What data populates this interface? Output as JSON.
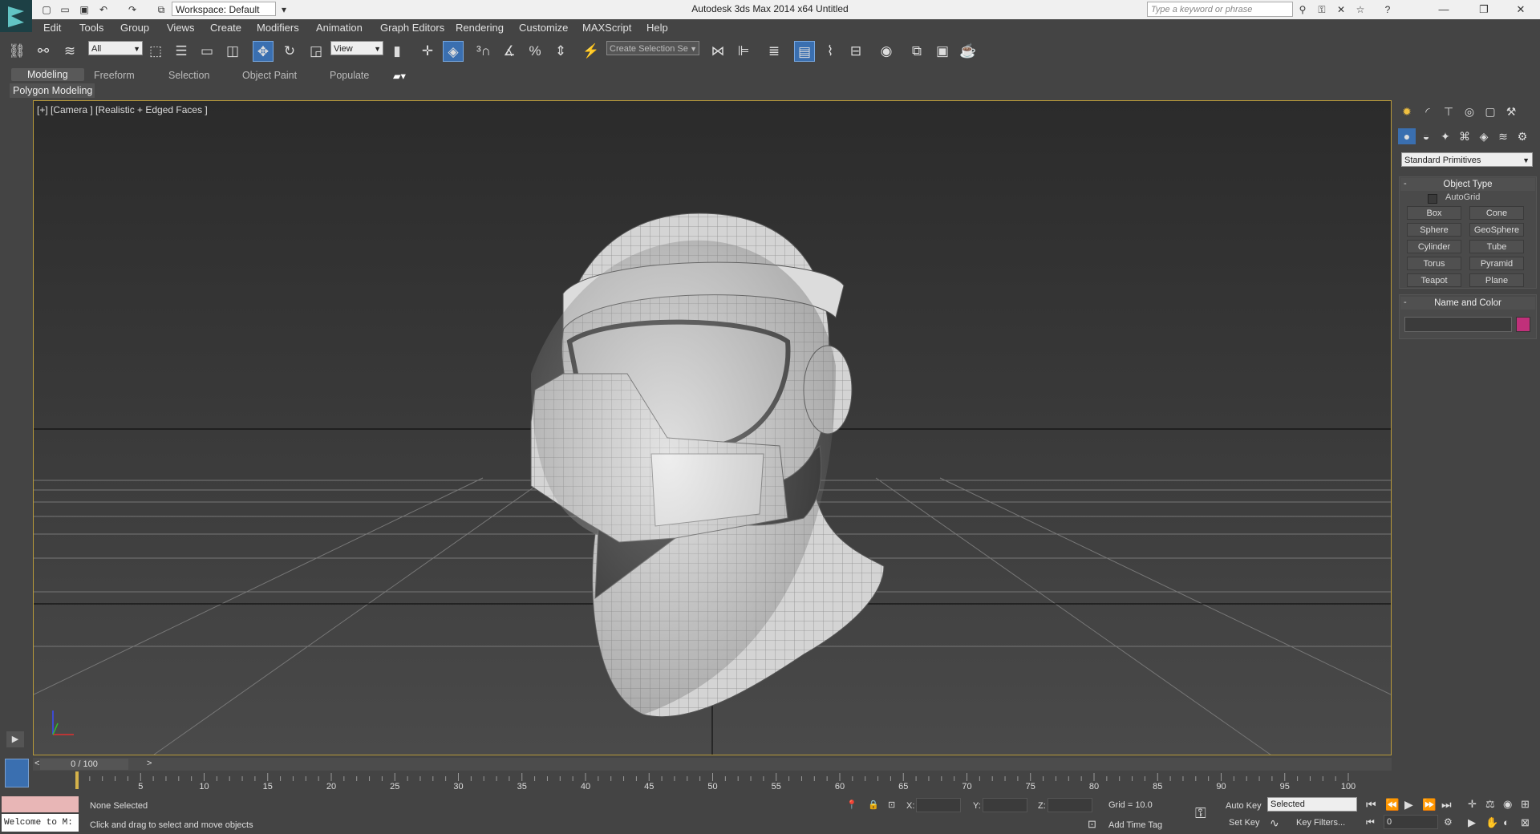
{
  "app": {
    "title": "Autodesk 3ds Max  2014 x64     Untitled",
    "workspace": "Workspace: Default",
    "search_placeholder": "Type a keyword or phrase"
  },
  "menu": [
    "Edit",
    "Tools",
    "Group",
    "Views",
    "Create",
    "Modifiers",
    "Animation",
    "Graph Editors",
    "Rendering",
    "Customize",
    "MAXScript",
    "Help"
  ],
  "toolbar": {
    "selection_filter": "All",
    "ref_coord": "View",
    "named_selection": "Create Selection Se"
  },
  "ribbon": {
    "tabs": [
      "Modeling",
      "Freeform",
      "Selection",
      "Object Paint",
      "Populate"
    ],
    "active_tab": "Modeling",
    "panel_label": "Polygon Modeling"
  },
  "viewport": {
    "label": "[+] [Camera ] [Realistic + Edged Faces ]"
  },
  "command_panel": {
    "category": "Standard Primitives",
    "object_type_title": "Object Type",
    "autogrid_label": "AutoGrid",
    "buttons": [
      "Box",
      "Cone",
      "Sphere",
      "GeoSphere",
      "Cylinder",
      "Tube",
      "Torus",
      "Pyramid",
      "Teapot",
      "Plane"
    ],
    "name_color_title": "Name and Color",
    "object_color": "#c0307a"
  },
  "timeline": {
    "frame_display": "0 / 100",
    "prev": "<",
    "next": ">",
    "ticks": [
      "5",
      "10",
      "15",
      "20",
      "25",
      "30",
      "35",
      "40",
      "45",
      "50",
      "55",
      "60",
      "65",
      "70",
      "75",
      "80",
      "85",
      "90",
      "95",
      "100"
    ]
  },
  "status": {
    "selection": "None Selected",
    "prompt": "Click and drag to select and move objects",
    "x_label": "X:",
    "y_label": "Y:",
    "z_label": "Z:",
    "grid": "Grid = 10.0",
    "add_time_tag": "Add Time Tag",
    "auto_key": "Auto Key",
    "set_key": "Set Key",
    "key_mode": "Selected",
    "key_filters": "Key Filters...",
    "current_frame": "0",
    "maxscript_listener": "Welcome to M:"
  }
}
